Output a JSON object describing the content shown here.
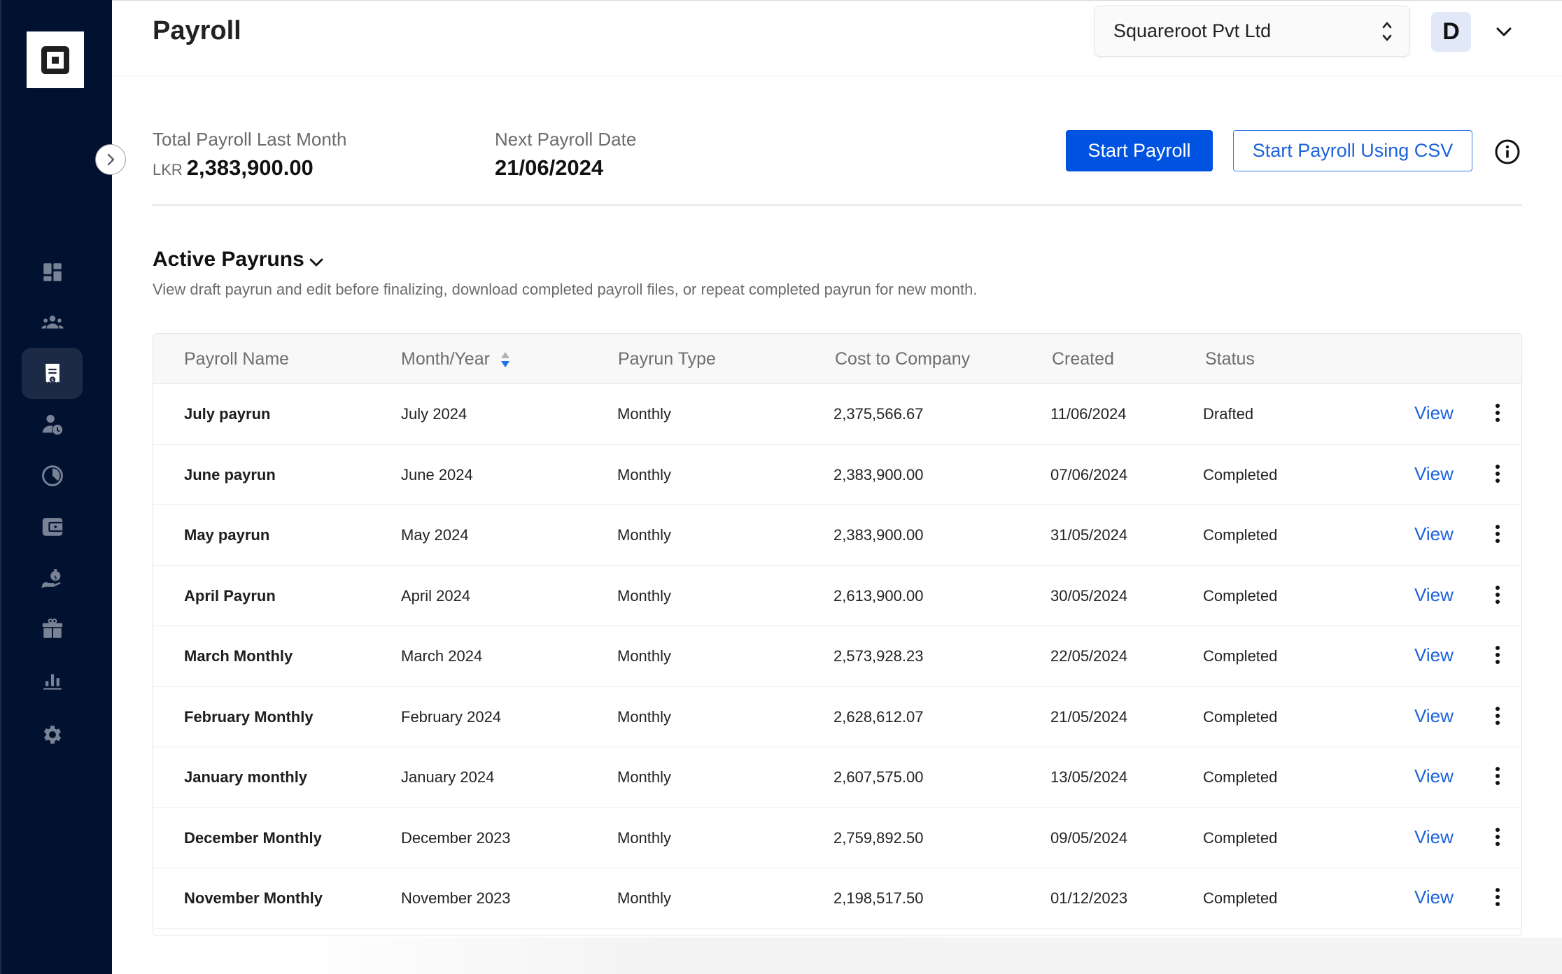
{
  "sidebar": {
    "logo": "square-logo",
    "items": [
      {
        "name": "dashboard",
        "icon": "dashboard-icon",
        "active": false
      },
      {
        "name": "employees",
        "icon": "people-icon",
        "active": false
      },
      {
        "name": "payroll",
        "icon": "receipt-icon",
        "active": true
      },
      {
        "name": "attendance",
        "icon": "user-clock-icon",
        "active": false
      },
      {
        "name": "time",
        "icon": "clock-icon",
        "active": false
      },
      {
        "name": "wallet",
        "icon": "wallet-icon",
        "active": false
      },
      {
        "name": "loans",
        "icon": "money-hand-icon",
        "active": false
      },
      {
        "name": "benefits",
        "icon": "gift-icon",
        "active": false
      },
      {
        "name": "reports",
        "icon": "bar-chart-icon",
        "active": false
      },
      {
        "name": "settings",
        "icon": "gear-icon",
        "active": false
      }
    ]
  },
  "header": {
    "title": "Payroll",
    "company": "Squareroot Pvt Ltd",
    "avatar_initial": "D"
  },
  "summary": {
    "total_label": "Total Payroll Last Month",
    "currency": "LKR",
    "total_value": "2,383,900.00",
    "next_label": "Next Payroll Date",
    "next_value": "21/06/2024",
    "start_button": "Start Payroll",
    "csv_button": "Start Payroll Using CSV"
  },
  "section": {
    "title": "Active Payruns",
    "description": "View draft payrun and edit before finalizing, download completed payroll files, or repeat completed payrun for new month."
  },
  "table": {
    "columns": [
      "Payroll Name",
      "Month/Year",
      "Payrun Type",
      "Cost to Company",
      "Created",
      "Status"
    ],
    "sort": {
      "column": "Month/Year",
      "direction": "descending"
    },
    "action_label": "View",
    "rows": [
      {
        "name": "July payrun",
        "month": "July 2024",
        "type": "Monthly",
        "cost": "2,375,566.67",
        "created": "11/06/2024",
        "status": "Drafted"
      },
      {
        "name": "June payrun",
        "month": "June 2024",
        "type": "Monthly",
        "cost": "2,383,900.00",
        "created": "07/06/2024",
        "status": "Completed"
      },
      {
        "name": "May payrun",
        "month": "May 2024",
        "type": "Monthly",
        "cost": "2,383,900.00",
        "created": "31/05/2024",
        "status": "Completed"
      },
      {
        "name": "April Payrun",
        "month": "April 2024",
        "type": "Monthly",
        "cost": "2,613,900.00",
        "created": "30/05/2024",
        "status": "Completed"
      },
      {
        "name": "March Monthly",
        "month": "March 2024",
        "type": "Monthly",
        "cost": "2,573,928.23",
        "created": "22/05/2024",
        "status": "Completed"
      },
      {
        "name": "February Monthly",
        "month": "February 2024",
        "type": "Monthly",
        "cost": "2,628,612.07",
        "created": "21/05/2024",
        "status": "Completed"
      },
      {
        "name": "January monthly",
        "month": "January 2024",
        "type": "Monthly",
        "cost": "2,607,575.00",
        "created": "13/05/2024",
        "status": "Completed"
      },
      {
        "name": "December Monthly",
        "month": "December 2023",
        "type": "Monthly",
        "cost": "2,759,892.50",
        "created": "09/05/2024",
        "status": "Completed"
      },
      {
        "name": "November Monthly",
        "month": "November 2023",
        "type": "Monthly",
        "cost": "2,198,517.50",
        "created": "01/12/2023",
        "status": "Completed"
      }
    ]
  },
  "colors": {
    "sidebar_bg": "#011230",
    "primary": "#0052e0",
    "link": "#1d63db",
    "sidebar_icon": "#7a8296"
  }
}
